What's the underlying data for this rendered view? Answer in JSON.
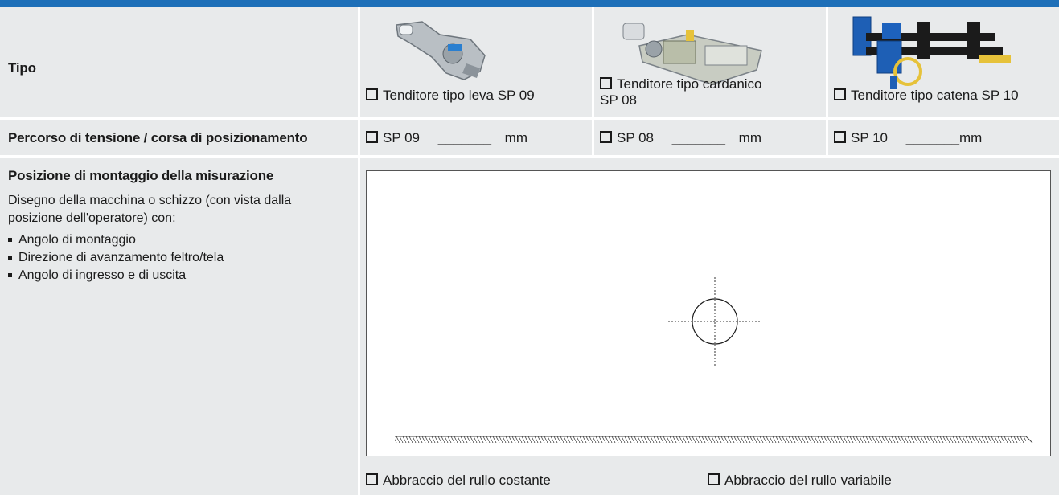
{
  "colors": {
    "accent_bar": "#1d6fb8",
    "row_bg": "#e8eaeb"
  },
  "tipo": {
    "label": "Tipo",
    "options": [
      {
        "label": "Tenditore tipo leva SP 09",
        "icon": "lever-tensioner-image"
      },
      {
        "label_line1": "Tenditore tipo cardanico",
        "label_line2": "SP 08",
        "icon": "cardan-tensioner-image"
      },
      {
        "label": "Tenditore tipo catena SP 10",
        "icon": "chain-tensioner-image"
      }
    ]
  },
  "percorso": {
    "label": "Percorso di tensione / corsa di posizionamento",
    "fields": [
      {
        "prefix": "SP 09",
        "blank": "_______",
        "unit": "mm"
      },
      {
        "prefix": "SP 08",
        "blank": "_______",
        "unit": "mm"
      },
      {
        "prefix": "SP 10",
        "blank": "_______",
        "unit": "mm"
      }
    ]
  },
  "posizione": {
    "title": "Posizione di montaggio della misurazione",
    "description_line1": "Disegno della macchina o schizzo (con vista dalla",
    "description_line2": "posizione dell'operatore) con:",
    "bullets": [
      "Angolo di montaggio",
      "Direzione di avanzamento feltro/tela",
      "Angolo di ingresso e di uscita"
    ]
  },
  "abbraccio": {
    "costante": "Abbraccio del rullo costante",
    "variabile": "Abbraccio del rullo variabile"
  }
}
